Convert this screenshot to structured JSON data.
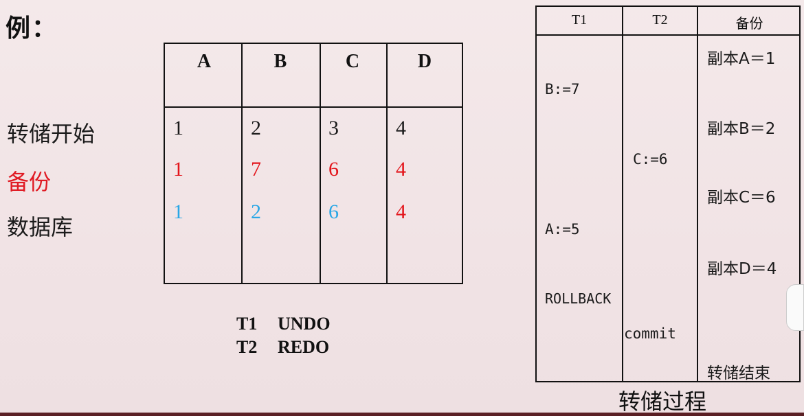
{
  "heading": "例：",
  "row_labels": {
    "dump_start": "转储开始",
    "backup": "备份",
    "database": "数据库"
  },
  "grid": {
    "headers": [
      "A",
      "B",
      "C",
      "D"
    ],
    "rows": [
      [
        "1",
        "2",
        "3",
        "4"
      ],
      [
        "1",
        "7",
        "6",
        "4"
      ],
      [
        "1",
        "2",
        "6",
        "4"
      ]
    ]
  },
  "legend": [
    {
      "txn": "T1",
      "action": "UNDO"
    },
    {
      "txn": "T2",
      "action": "REDO"
    }
  ],
  "process_table": {
    "headers": [
      "T1",
      "T2",
      "备份"
    ],
    "t1": [
      "B:=7",
      "A:=5",
      "ROLLBACK"
    ],
    "t2": [
      "C:=6",
      "commit"
    ],
    "backup": [
      "副本A＝1",
      "副本B＝2",
      "副本C＝6",
      "副本D＝4",
      "转储结束"
    ]
  },
  "caption": "转储过程",
  "colors": {
    "black": "#1a1a1a",
    "red": "#e3151b",
    "blue": "#2aa7e6"
  }
}
